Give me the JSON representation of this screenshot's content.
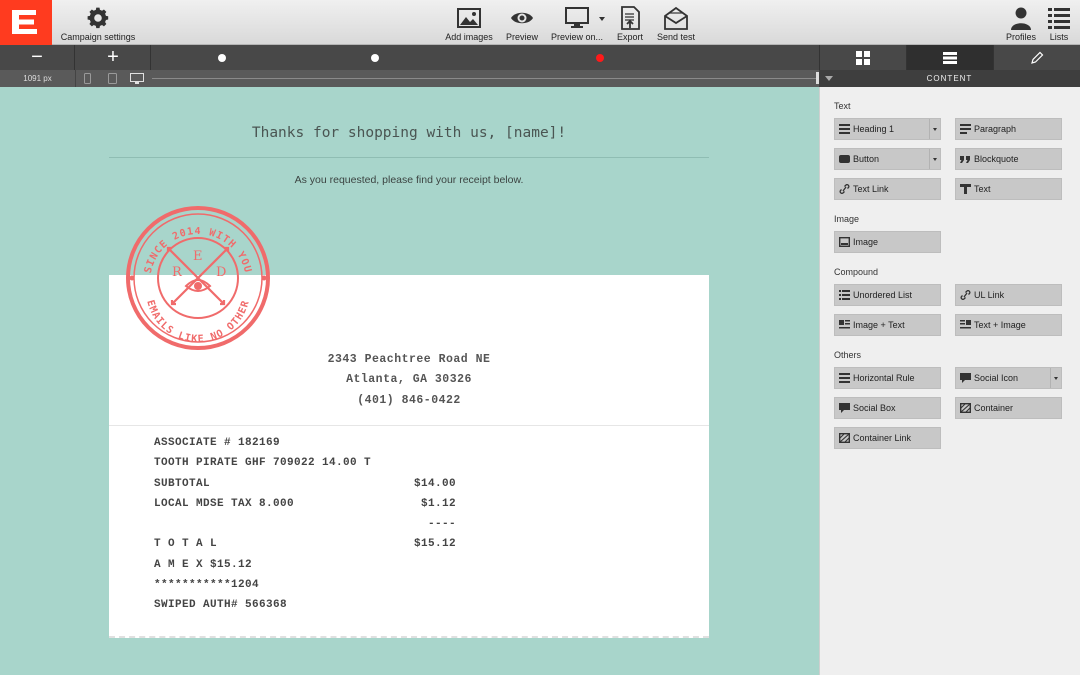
{
  "toolbar": {
    "campaign_settings": "Campaign settings",
    "add_images": "Add images",
    "preview": "Preview",
    "preview_on": "Preview on...",
    "export": "Export",
    "send_test": "Send test",
    "profiles": "Profiles",
    "lists": "Lists"
  },
  "zoom": {
    "minus": "−",
    "plus": "+"
  },
  "viewport": {
    "width_label": "1091 px"
  },
  "panel_tab_label": "CONTENT",
  "email": {
    "headline": "Thanks for shopping with us, [name]!",
    "subline": "As you requested, please find your receipt below.",
    "address": [
      "2343 Peachtree Road NE",
      "Atlanta, GA 30326",
      "(401) 846-0422"
    ],
    "receipt_lines": [
      {
        "text": "ASSOCIATE # 182169",
        "amount": ""
      },
      {
        "text": "TOOTH PIRATE GHF 709022 14.00 T",
        "amount": ""
      },
      {
        "text": "SUBTOTAL",
        "amount": "$14.00"
      },
      {
        "text": "LOCAL MDSE TAX 8.000",
        "amount": "$1.12"
      },
      {
        "text": "",
        "amount": "----"
      },
      {
        "text": "T O T A L",
        "amount": "$15.12"
      },
      {
        "text": "A M E X $15.12",
        "amount": ""
      },
      {
        "text": "***********1204",
        "amount": ""
      },
      {
        "text": "SWIPED AUTH# 566368",
        "amount": ""
      }
    ],
    "stamp": {
      "top_text": "SINCE 2014 WITH YOU",
      "bottom_text": "EMAILS LIKE NO OTHER",
      "letters": [
        "R",
        "E",
        "D"
      ],
      "color": "#f06b6b"
    }
  },
  "panel": {
    "sections": {
      "text": "Text",
      "image": "Image",
      "compound": "Compound",
      "others": "Others"
    },
    "buttons": {
      "heading1": "Heading 1",
      "paragraph": "Paragraph",
      "button": "Button",
      "blockquote": "Blockquote",
      "text_link": "Text Link",
      "text": "Text",
      "image": "Image",
      "unordered_list": "Unordered List",
      "ul_link": "UL Link",
      "image_text": "Image + Text",
      "text_image": "Text + Image",
      "horizontal_rule": "Horizontal Rule",
      "social_icon": "Social Icon",
      "social_box": "Social Box",
      "container": "Container",
      "container_link": "Container Link"
    }
  },
  "colors": {
    "brand": "#ff3b1f",
    "canvas_bg": "#a8d5cb",
    "active_dot": "#ff1a1a",
    "stamp": "#f06b6b"
  }
}
